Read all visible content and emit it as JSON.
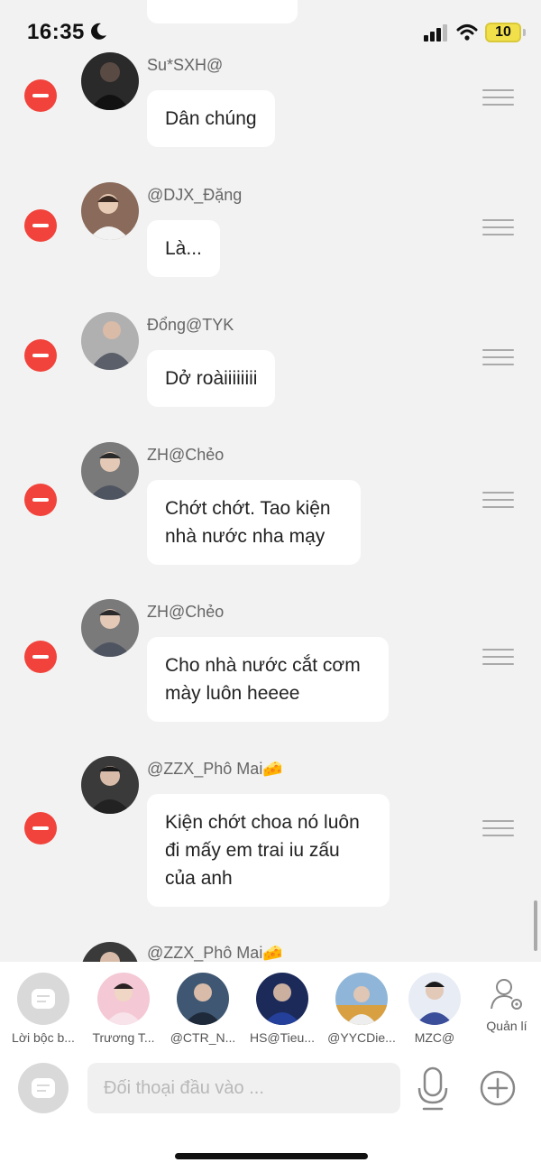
{
  "status_bar": {
    "time": "16:35",
    "battery": "10"
  },
  "messages": [
    {
      "sender": "Su*SXH@",
      "text": "Dân chúng"
    },
    {
      "sender": "@DJX_Đặng",
      "text": "Là..."
    },
    {
      "sender": "Đổng@TYK",
      "text": "Dở roàiiiiiiii"
    },
    {
      "sender": "ZH@Chẻo",
      "text": "Chớt chớt. Tao kiện nhà nước nha mạy"
    },
    {
      "sender": "ZH@Chẻo",
      "text": "Cho nhà nước cắt cơm mày luôn heeee"
    },
    {
      "sender": "@ZZX_Phô Mai🧀",
      "text": "Kiện chớt choa nó luôn đi mấy em trai iu zấu của anh"
    },
    {
      "sender": "@ZZX_Phô Mai🧀",
      "text": ""
    }
  ],
  "shortcuts": [
    {
      "label": "Lời bộc b..."
    },
    {
      "label": "Trương T..."
    },
    {
      "label": "@CTR_N..."
    },
    {
      "label": "HS@Tieu..."
    },
    {
      "label": "@YYCDie..."
    },
    {
      "label": "MZC@"
    }
  ],
  "manage": {
    "label": "Quản lí"
  },
  "input": {
    "placeholder": "Đối thoại đầu vào ..."
  },
  "colors": {
    "remove": "#f1433b",
    "background": "#f2f2f2",
    "bubble": "#ffffff"
  }
}
